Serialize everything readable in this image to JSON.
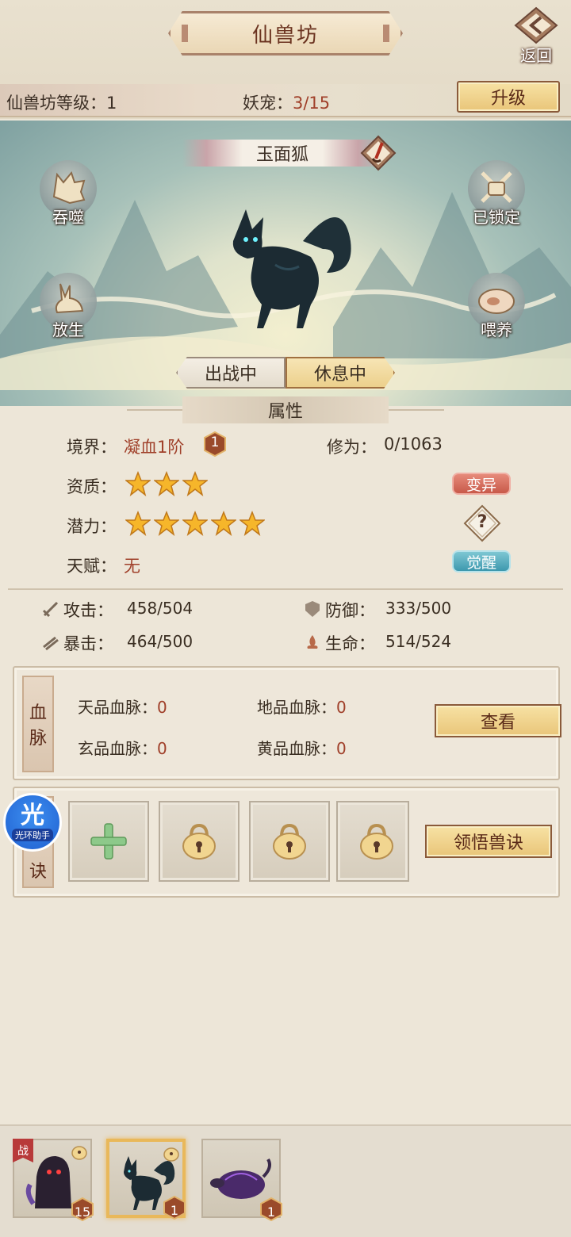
{
  "header": {
    "title": "仙兽坊",
    "back_label": "返回"
  },
  "level_bar": {
    "level_label": "仙兽坊等级：",
    "level_value": "1",
    "pets_label": "妖宠：",
    "pets_value": "3/15",
    "upgrade_label": "升级"
  },
  "pet": {
    "name": "玉面狐",
    "actions": {
      "devour": "吞噬",
      "locked": "已锁定",
      "release": "放生",
      "feed": "喂养"
    },
    "status_tabs": {
      "fighting": "出战中",
      "resting": "休息中",
      "selected": "resting"
    }
  },
  "attributes": {
    "header": "属性",
    "realm_label": "境界：",
    "realm_value": "凝血1阶",
    "realm_badge": "1",
    "cultivation_label": "修为：",
    "cultivation_value": "0/1063",
    "aptitude_label": "资质：",
    "aptitude_stars": 3,
    "potential_label": "潜力：",
    "potential_stars": 5,
    "talent_label": "天赋：",
    "talent_value": "无",
    "mutate_label": "变异",
    "awaken_label": "觉醒",
    "help_glyph": "?",
    "stats": {
      "attack_label": "攻击：",
      "attack_value": "458/504",
      "defense_label": "防御：",
      "defense_value": "333/500",
      "crit_label": "暴击：",
      "crit_value": "464/500",
      "life_label": "生命：",
      "life_value": "514/524"
    }
  },
  "bloodline": {
    "tag_1": "血",
    "tag_2": "脉",
    "heaven_label": "天品血脉：",
    "heaven_value": "0",
    "earth_label": "地品血脉：",
    "earth_value": "0",
    "mystic_label": "玄品血脉：",
    "mystic_value": "0",
    "yellow_label": "黄品血脉：",
    "yellow_value": "0",
    "view_label": "查看"
  },
  "skills": {
    "tag_bottom": "诀",
    "learn_label": "领悟兽诀"
  },
  "overlay": {
    "big": "光",
    "small": "光环助手"
  },
  "pet_list": [
    {
      "level": "15",
      "battle_flag": "战"
    },
    {
      "level": "1"
    },
    {
      "level": "1"
    }
  ],
  "colors": {
    "accent_red": "#a0402a",
    "button_gold": "#e9c579",
    "awaken_blue": "#3d98ae",
    "mutate_red": "#c85a4a"
  }
}
